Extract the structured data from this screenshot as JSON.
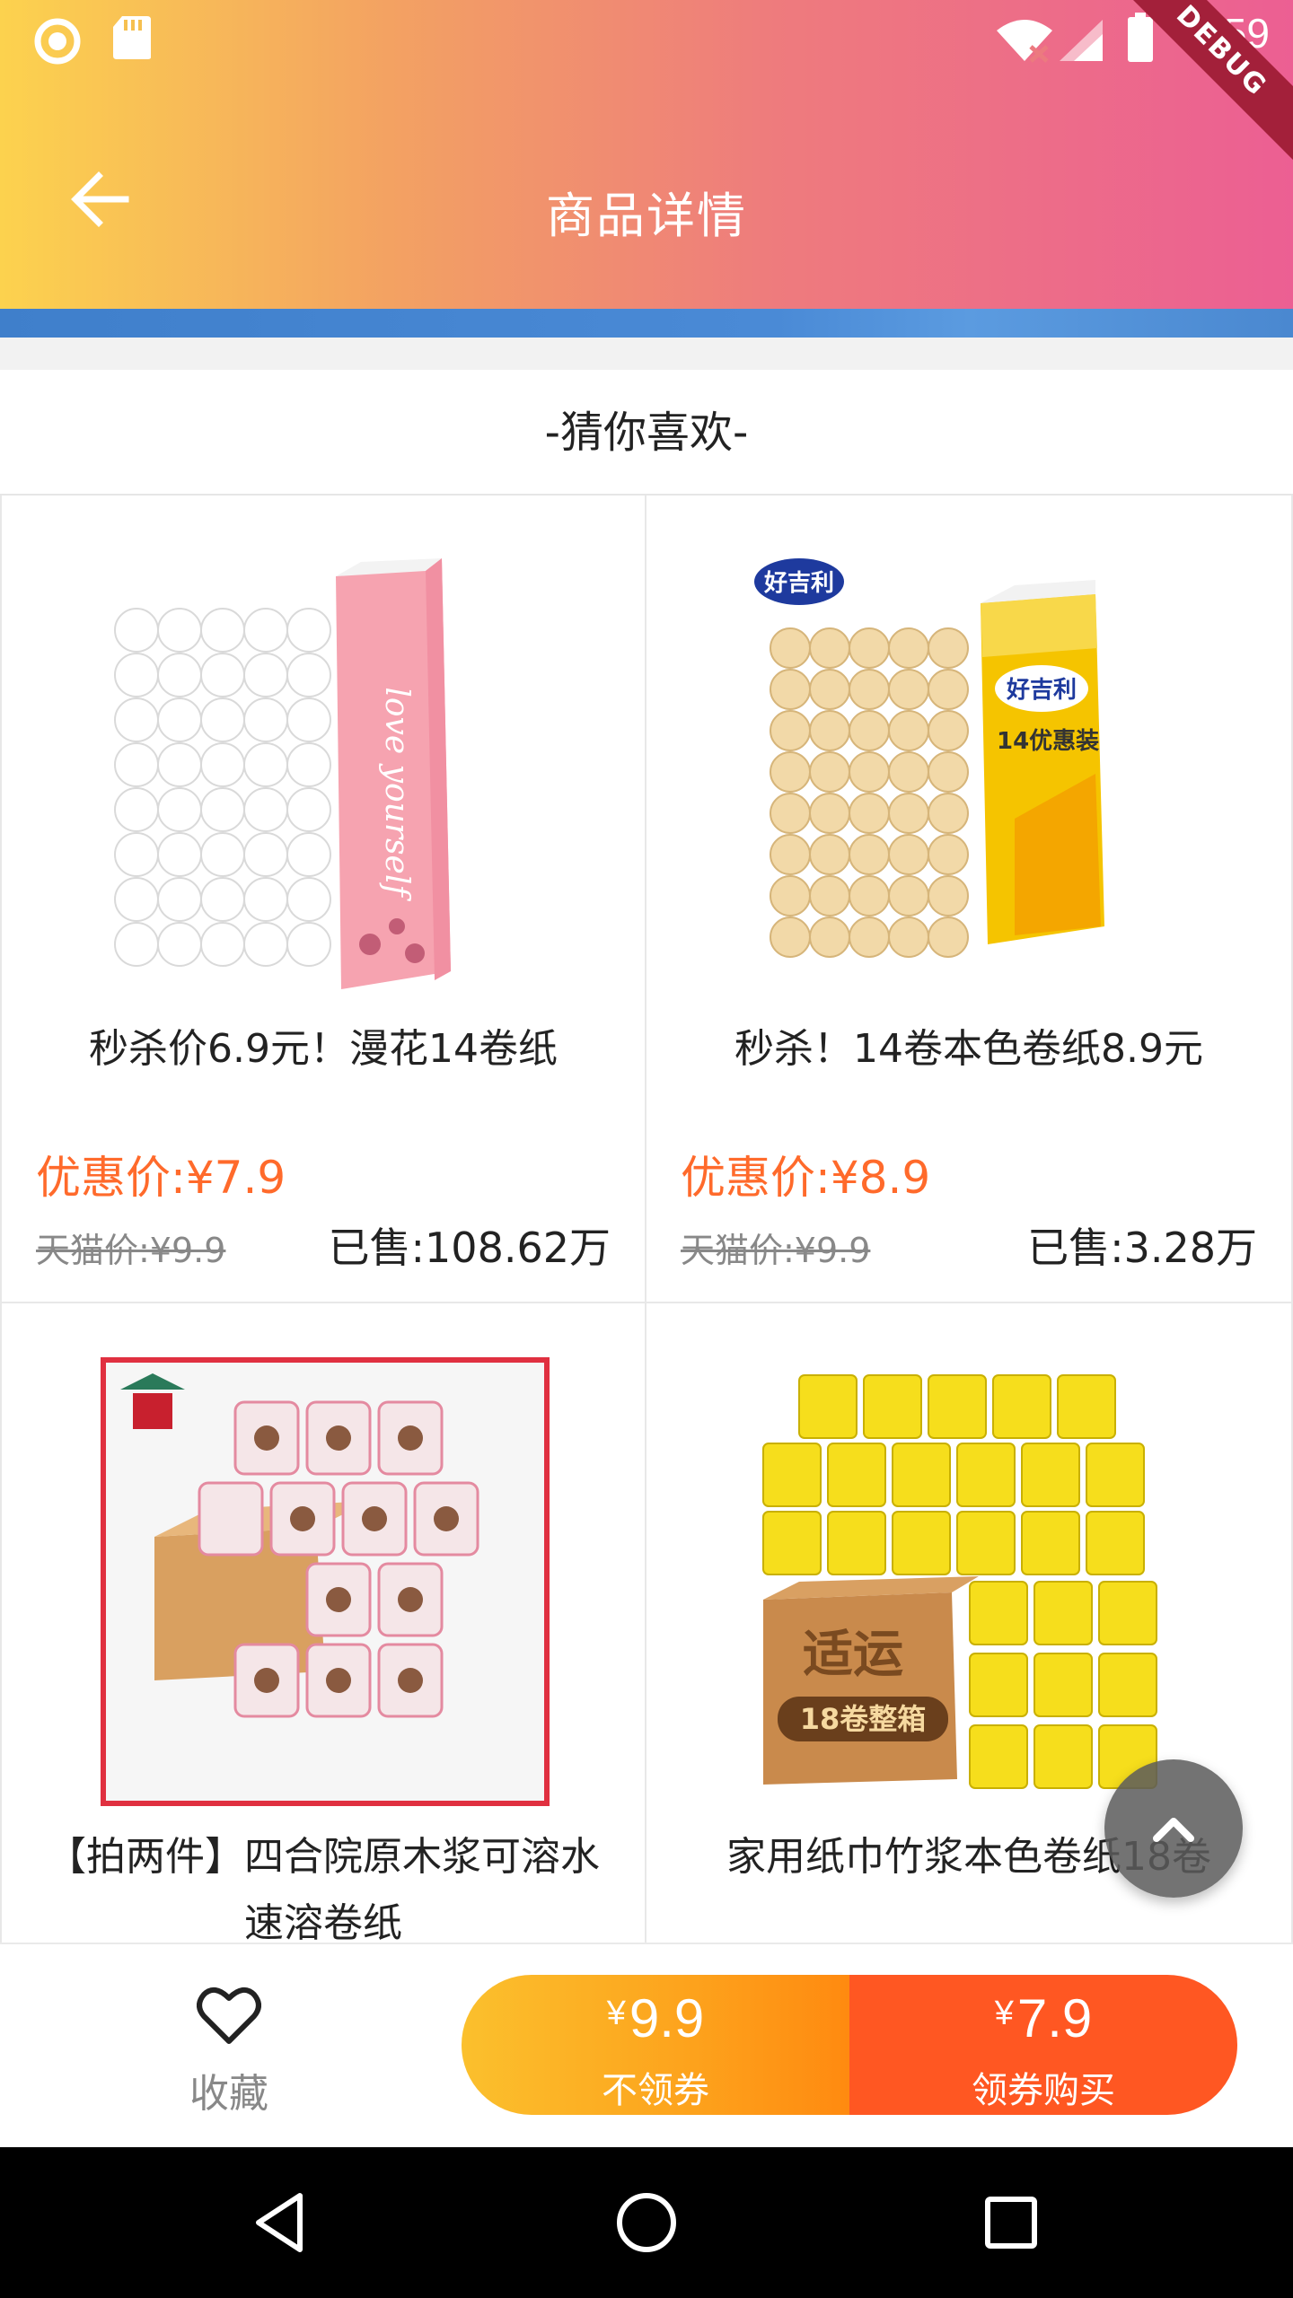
{
  "status_bar": {
    "time": "1:59",
    "debug_label": "DEBUG"
  },
  "header": {
    "title": "商品详情"
  },
  "section": {
    "title": "-猜你喜欢-"
  },
  "products": [
    {
      "title": "秒杀价6.9元！漫花14卷纸",
      "price": "优惠价:¥7.9",
      "original_price": "天猫价:¥9.9",
      "sold": "已售:108.62万"
    },
    {
      "title": "秒杀！14卷本色卷纸8.9元",
      "price": "优惠价:¥8.9",
      "original_price": "天猫价:¥9.9",
      "sold": "已售:3.28万"
    },
    {
      "title": "【拍两件】四合院原木浆可溶水速溶卷纸"
    },
    {
      "title": "家用纸巾竹浆本色卷纸18卷"
    }
  ],
  "product_image_text": {
    "brand_haojili": "好吉利",
    "pack_14": "14优惠装",
    "love_yourself": "love yourself",
    "brand_shiyun": "适运",
    "box_18": "18卷整箱"
  },
  "bottom_bar": {
    "favorite_label": "收藏",
    "no_coupon": {
      "currency": "¥",
      "price": "9.9",
      "label": "不领券"
    },
    "with_coupon": {
      "currency": "¥",
      "price": "7.9",
      "label": "领券购买"
    }
  },
  "colors": {
    "accent_price": "#ff6a2b",
    "buy_orange": "#ff5722",
    "buy_yellow": "#fbc02d"
  }
}
